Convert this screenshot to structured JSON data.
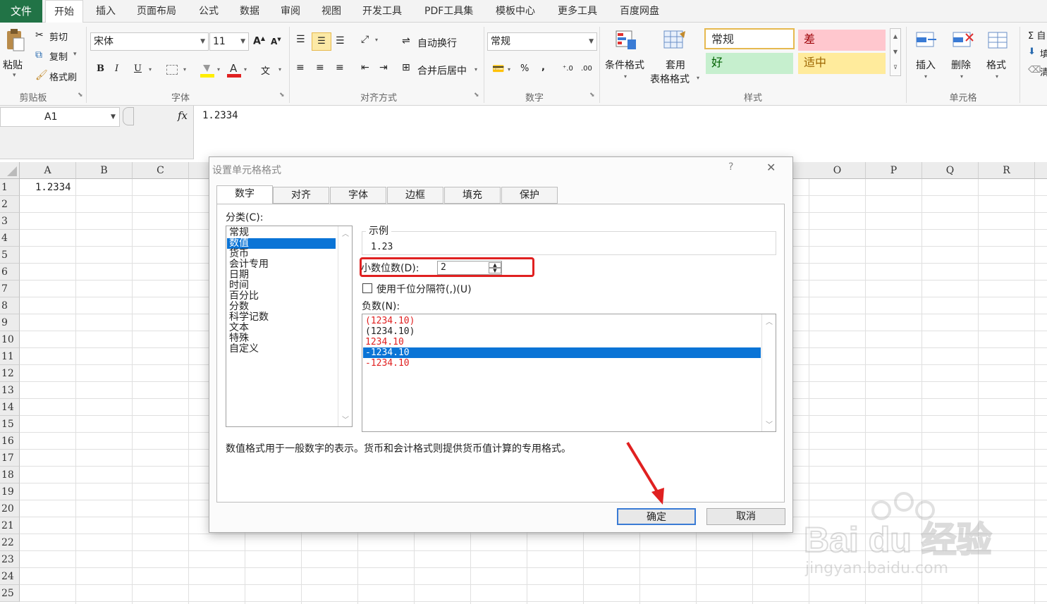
{
  "menu": {
    "file": "文件",
    "tabs": [
      "开始",
      "插入",
      "页面布局",
      "公式",
      "数据",
      "审阅",
      "视图",
      "开发工具",
      "PDF工具集",
      "模板中心",
      "更多工具",
      "百度网盘"
    ]
  },
  "ribbon": {
    "clipboard": {
      "paste": "粘贴",
      "cut": "剪切",
      "copy": "复制",
      "painter": "格式刷",
      "label": "剪贴板"
    },
    "font": {
      "name": "宋体",
      "size": "11",
      "label": "字体"
    },
    "align": {
      "wrap": "自动换行",
      "merge": "合并后居中",
      "label": "对齐方式"
    },
    "number": {
      "format": "常规",
      "percent": "%",
      "comma": ",",
      "label": "数字"
    },
    "styles": {
      "cond": "条件格式",
      "table1": "套用",
      "table2": "表格格式",
      "normal": "常规",
      "bad": "差",
      "good": "好",
      "neutral": "适中",
      "label": "样式"
    },
    "cells": {
      "insert": "插入",
      "delete": "删除",
      "format": "格式",
      "label": "单元格"
    },
    "edit": {
      "sum": "Σ 自",
      "fill": "填",
      "clear": "清"
    }
  },
  "formula_bar": {
    "name_box": "A1",
    "fx": "fx",
    "content": "1.2334"
  },
  "grid": {
    "left_cols": [
      "A",
      "B",
      "C"
    ],
    "right_cols": [
      "O",
      "P",
      "Q",
      "R"
    ],
    "rows": [
      "1",
      "2",
      "3",
      "4",
      "5",
      "6",
      "7",
      "8",
      "9",
      "10",
      "11",
      "12",
      "13",
      "14",
      "15",
      "16",
      "17",
      "18",
      "19",
      "20",
      "21",
      "22",
      "23",
      "24",
      "25"
    ],
    "a1": "1.2334"
  },
  "dialog": {
    "title": "设置单元格格式",
    "help": "?",
    "close": "✕",
    "tabs": [
      "数字",
      "对齐",
      "字体",
      "边框",
      "填充",
      "保护"
    ],
    "category_label": "分类(C):",
    "categories": [
      "常规",
      "数值",
      "货币",
      "会计专用",
      "日期",
      "时间",
      "百分比",
      "分数",
      "科学记数",
      "文本",
      "特殊",
      "自定义"
    ],
    "selected_category": "数值",
    "sample_label": "示例",
    "sample_value": "1.23",
    "decimal_label": "小数位数(D):",
    "decimal_value": "2",
    "thousands_label": "使用千位分隔符(,)(U)",
    "negative_label": "负数(N):",
    "negative_options": [
      "(1234.10)",
      "(1234.10)",
      "1234.10",
      "-1234.10",
      "-1234.10"
    ],
    "negative_selected": 3,
    "description": "数值格式用于一般数字的表示。货币和会计格式则提供货币值计算的专用格式。",
    "ok": "确定",
    "cancel": "取消"
  },
  "watermark": {
    "brand": "Bai du 经验",
    "url": "jingyan.baidu.com"
  },
  "colors": {
    "excel_green": "#217346",
    "selection_blue": "#0a74d6",
    "highlight_red": "#e02020"
  }
}
